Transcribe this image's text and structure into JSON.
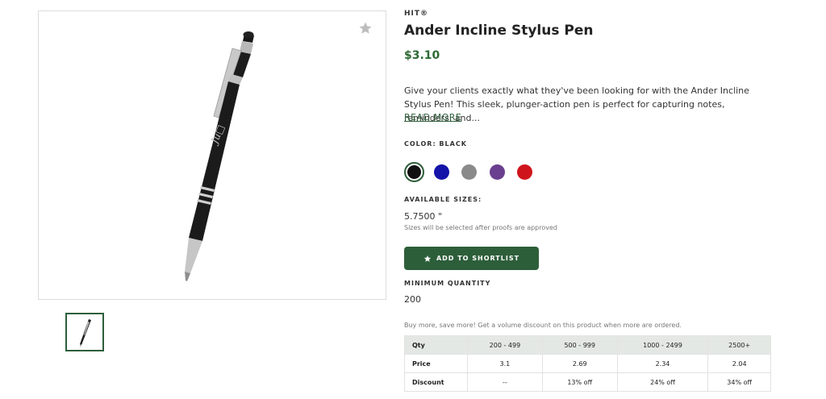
{
  "product": {
    "brand": "HIT®",
    "title": "Ander Incline Stylus Pen",
    "price": "$3.10",
    "description": "Give your clients exactly what they've been looking for with the Ander Incline Stylus Pen! This sleek, plunger-action pen is perfect for capturing notes, reminders, and...",
    "read_more": "READ MORE",
    "imprint_text": "Ju□"
  },
  "color": {
    "label": "COLOR: BLACK",
    "swatches": [
      {
        "name": "black",
        "hex": "#111111",
        "selected": true
      },
      {
        "name": "blue",
        "hex": "#1414a8",
        "selected": false
      },
      {
        "name": "gray",
        "hex": "#8a8a8a",
        "selected": false
      },
      {
        "name": "purple",
        "hex": "#6a3f8f",
        "selected": false
      },
      {
        "name": "red",
        "hex": "#d0141c",
        "selected": false
      }
    ]
  },
  "sizes": {
    "label": "AVAILABLE SIZES:",
    "value": "5.7500 \"",
    "note": "Sizes will be selected after proofs are approved"
  },
  "actions": {
    "shortlist_label": "ADD TO SHORTLIST",
    "shortlist_icon": "star-icon"
  },
  "minimum": {
    "label": "MINIMUM QUANTITY",
    "value": "200"
  },
  "volume": {
    "note": "Buy more, save more! Get a volume discount on this product when more are ordered.",
    "headers": [
      "Qty",
      "200 - 499",
      "500 - 999",
      "1000 - 2499",
      "2500+"
    ],
    "rows": [
      [
        "Price",
        "3.1",
        "2.69",
        "2.34",
        "2.04"
      ],
      [
        "Discount",
        "--",
        "13% off",
        "24% off",
        "34% off"
      ]
    ]
  },
  "colors": {
    "accent": "#2d5e3a",
    "price": "#2d6a35"
  }
}
